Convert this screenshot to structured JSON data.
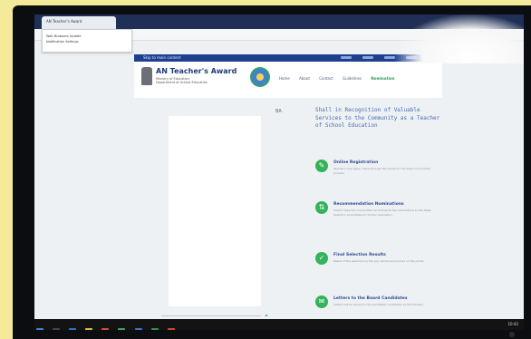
{
  "browser": {
    "tab_title": "AN Teacher's Award",
    "popup_line1": "Web Browsers Update",
    "popup_line2": "Notification Settings"
  },
  "site": {
    "top_strip_label": "Skip to main content",
    "title": "AN Teacher's Award",
    "subtitle_line1": "Ministry of Education",
    "subtitle_line2": "Department of School Education",
    "nav": [
      "Home",
      "About",
      "Contact",
      "Guidelines",
      "Nomination"
    ],
    "ba_tag": "BA"
  },
  "main": {
    "intro": "Shall in Recognition of Valuable Services to the Community as a Teacher of School Education",
    "items": [
      {
        "title": "Online Registration",
        "desc": "Teachers may apply online through the portal for the award nomination process."
      },
      {
        "title": "Recommendation Nominations",
        "desc": "District Selection Committee recommends the nominations to the State Selection Committee for further evaluation."
      },
      {
        "title": "Final Selection Results",
        "desc": "Result of the selection by the Jury will be announced on the portal."
      },
      {
        "title": "Letters to the Board Candidates",
        "desc": "Letters will be issued to the shortlisted candidates by the Ministry."
      }
    ]
  },
  "taskbar": {
    "time": "10:42"
  },
  "colors": {
    "accent_green": "#35b35b",
    "site_blue": "#1d3f8f"
  }
}
